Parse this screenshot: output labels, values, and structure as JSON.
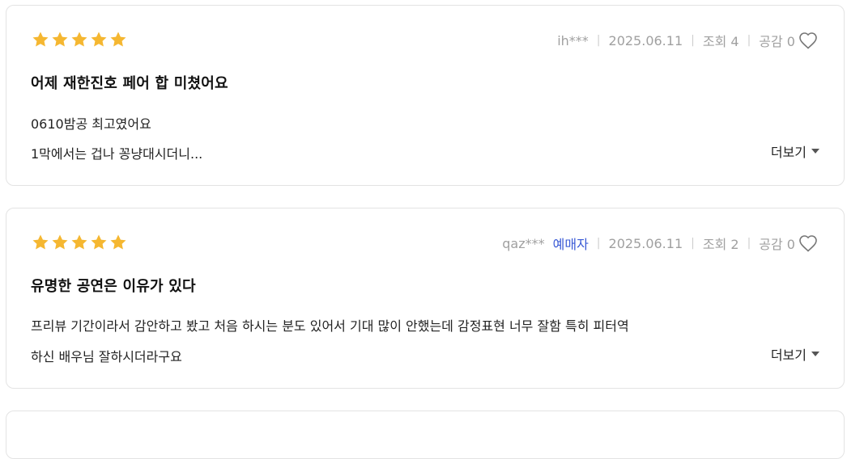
{
  "reviews": [
    {
      "rating": 5,
      "user": "ih***",
      "buyer_badge": "",
      "date": "2025.06.11",
      "views": "조회 4",
      "likes": "공감 0",
      "title": "어제 재한진호 페어 합 미쳤어요",
      "line1": "0610밤공 최고였어요",
      "line2": "1막에서는 겁나 꽁냥대시더니...",
      "more_label": "더보기"
    },
    {
      "rating": 5,
      "user": "qaz***",
      "buyer_badge": "예매자",
      "date": "2025.06.11",
      "views": "조회 2",
      "likes": "공감 0",
      "title": "유명한 공연은 이유가 있다",
      "line1": "프리뷰 기간이라서 감안하고 봤고 처음 하시는 분도 있어서 기대 많이 안했는데 감정표현 너무 잘함 특히 피터역",
      "line2": "하신 배우님 잘하시더라구요",
      "more_label": "더보기"
    }
  ],
  "colors": {
    "star": "#f5b731",
    "meta_text": "#a0a0a0",
    "buyer_badge": "#3b5bd6",
    "card_border": "#e3e3e3"
  }
}
